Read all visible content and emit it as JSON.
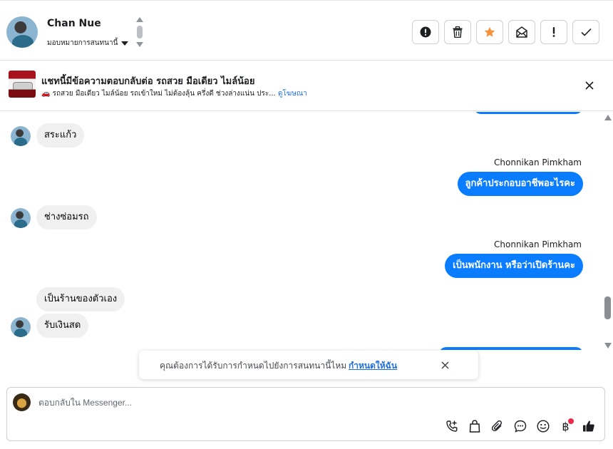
{
  "header": {
    "contact_name": "Chan Nue",
    "assign_label": "มอบหมายการสนทนานี้",
    "actions": [
      {
        "icon": "alert-circle-icon",
        "name": "spam-button"
      },
      {
        "icon": "trash-icon",
        "name": "delete-button"
      },
      {
        "icon": "star-icon",
        "name": "follow-up-button"
      },
      {
        "icon": "mark-unread-icon",
        "name": "mark-unread-button"
      },
      {
        "icon": "exclamation-icon",
        "name": "important-button"
      },
      {
        "icon": "check-icon",
        "name": "done-button"
      }
    ],
    "colors": {
      "star": "#f7923b",
      "border": "#ccd0d5"
    }
  },
  "banner": {
    "title": "แชทนี้มีข้อความตอบกลับต่อ รถสวย มือเดียว ไมล์น้อย",
    "subtitle": "🚗 รถสวย มือเดียว ไมล์น้อย รถเข้าใหม่ ไม่ต้องลุ้น ครึ่งดี ช่วงล่างแน่น ประ...",
    "link": "ดูโฆษณา"
  },
  "messages": [
    {
      "direction": "in",
      "text": "สระแก้ว"
    },
    {
      "direction": "out",
      "sender": "Chonnikan Pimkham",
      "text": "ลูกค้าประกอบอาชีพอะไรคะ"
    },
    {
      "direction": "in",
      "text": "ช่างซ่อมรถ"
    },
    {
      "direction": "out",
      "sender": "Chonnikan Pimkham",
      "text": "เป็นพนักงาน หรือว่าเปิดร้านคะ"
    },
    {
      "direction": "in",
      "text": "เป็นร้านของตัวเอง"
    },
    {
      "direction": "in",
      "text": "รับเงินสด"
    }
  ],
  "toast": {
    "message": "คุณต้องการได้รับการกำหนดไปยังการสนทนานี้ไหม",
    "action": "กำหนดให้ฉัน"
  },
  "composer": {
    "placeholder": "ตอบกลับใน Messenger...",
    "baht_symbol": "฿",
    "tools": [
      "phone-add-icon",
      "shopping-bag-icon",
      "paperclip-icon",
      "chat-bubble-icon",
      "emoji-icon",
      "baht-icon",
      "thumbs-up-icon"
    ]
  },
  "colors": {
    "outgoing_bubble": "#0a7cff",
    "incoming_bubble": "#f0f0f0",
    "link": "#216fdb",
    "notification_dot": "#f02849"
  }
}
